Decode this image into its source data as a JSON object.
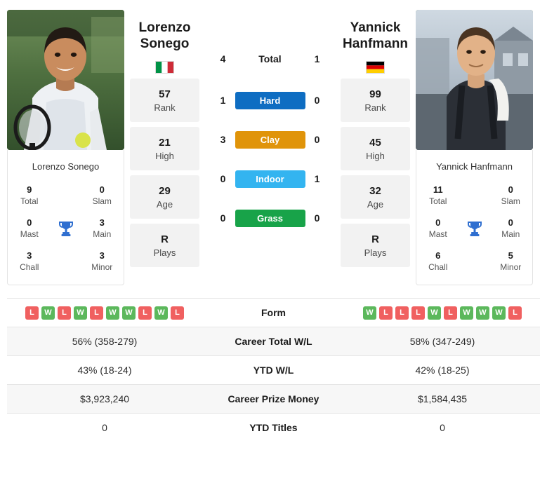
{
  "players": {
    "left": {
      "name": "Lorenzo Sonego",
      "name_line1": "Lorenzo",
      "name_line2": "Sonego",
      "photo_caption": "Lorenzo Sonego",
      "country": "Italy",
      "flag": "it-flag-icon",
      "stats": [
        {
          "value": "57",
          "label": "Rank"
        },
        {
          "value": "21",
          "label": "High"
        },
        {
          "value": "29",
          "label": "Age"
        },
        {
          "value": "R",
          "label": "Plays"
        }
      ],
      "titles": {
        "total": {
          "value": "9",
          "label": "Total"
        },
        "slam": {
          "value": "0",
          "label": "Slam"
        },
        "mast": {
          "value": "0",
          "label": "Mast"
        },
        "main": {
          "value": "3",
          "label": "Main"
        },
        "chall": {
          "value": "3",
          "label": "Chall"
        },
        "minor": {
          "value": "3",
          "label": "Minor"
        }
      }
    },
    "right": {
      "name": "Yannick Hanfmann",
      "name_line1": "Yannick",
      "name_line2": "Hanfmann",
      "photo_caption": "Yannick Hanfmann",
      "country": "Germany",
      "flag": "de-flag-icon",
      "stats": [
        {
          "value": "99",
          "label": "Rank"
        },
        {
          "value": "45",
          "label": "High"
        },
        {
          "value": "32",
          "label": "Age"
        },
        {
          "value": "R",
          "label": "Plays"
        }
      ],
      "titles": {
        "total": {
          "value": "11",
          "label": "Total"
        },
        "slam": {
          "value": "0",
          "label": "Slam"
        },
        "mast": {
          "value": "0",
          "label": "Mast"
        },
        "main": {
          "value": "0",
          "label": "Main"
        },
        "chall": {
          "value": "6",
          "label": "Chall"
        },
        "minor": {
          "value": "5",
          "label": "Minor"
        }
      }
    }
  },
  "h2h": [
    {
      "label": "Total",
      "left": "4",
      "right": "1",
      "color": ""
    },
    {
      "label": "Hard",
      "left": "1",
      "right": "0",
      "color": "#0e6dc2"
    },
    {
      "label": "Clay",
      "left": "3",
      "right": "0",
      "color": "#e0940a"
    },
    {
      "label": "Indoor",
      "left": "0",
      "right": "1",
      "color": "#33b4f0"
    },
    {
      "label": "Grass",
      "left": "0",
      "right": "0",
      "color": "#18a349"
    }
  ],
  "comparison": {
    "form": {
      "label": "Form",
      "left": [
        "L",
        "W",
        "L",
        "W",
        "L",
        "W",
        "W",
        "L",
        "W",
        "L"
      ],
      "right": [
        "W",
        "L",
        "L",
        "L",
        "W",
        "L",
        "W",
        "W",
        "W",
        "L"
      ]
    },
    "rows": [
      {
        "label": "Career Total W/L",
        "left": "56% (358-279)",
        "right": "58% (347-249)"
      },
      {
        "label": "YTD W/L",
        "left": "43% (18-24)",
        "right": "42% (18-25)"
      },
      {
        "label": "Career Prize Money",
        "left": "$3,923,240",
        "right": "$1,584,435"
      },
      {
        "label": "YTD Titles",
        "left": "0",
        "right": "0"
      }
    ]
  },
  "colors": {
    "win": "#5cb85c",
    "loss": "#f06060",
    "hard": "#0e6dc2",
    "clay": "#e0940a",
    "indoor": "#33b4f0",
    "grass": "#18a349"
  }
}
